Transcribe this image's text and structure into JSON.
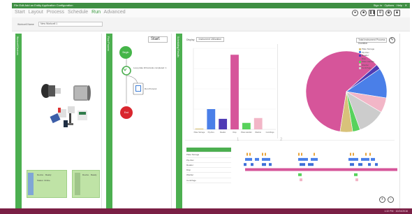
{
  "window": {
    "title_left": "File  Edit  Add an Entity  Application  Configuration",
    "title_right": "Sign in  ·  Options  ·  Help  ·  ✕"
  },
  "menu": {
    "items": [
      {
        "label": "Start"
      },
      {
        "label": "Layout"
      },
      {
        "label": "Process"
      },
      {
        "label": "Schedule"
      },
      {
        "label": "Run",
        "active": true
      },
      {
        "label": "Advanced"
      }
    ],
    "tool_icons": [
      "record-icon",
      "stop-icon",
      "pause-icon",
      "settings-icon",
      "database-icon",
      "user-icon"
    ]
  },
  "subbar": {
    "label": "Workcell Name",
    "select_value": "New Workcell 1"
  },
  "side_labels": {
    "devices": "Workcell Devices",
    "process": "Flow Process",
    "schedule": "Scheduling Results"
  },
  "devices": {
    "box1": {
      "title": "Device · Ready",
      "sub": "Status: Online"
    },
    "box2": {
      "title": "Device · Ready"
    }
  },
  "flow": {
    "start_select": "Start",
    "begin_label": "Begin",
    "end_label": "End",
    "loop_label": "Loop plate till barcode completed: 1",
    "step_label": "Run Protocol"
  },
  "chart_controls": {
    "label": "Display",
    "dropdown": "Instrument Utilization",
    "right_dropdown": "Total Instrument Process Duration"
  },
  "colors": {
    "green": "#4caf50",
    "dark_green": "#3f8f43",
    "taskbar": "#7a1f45"
  },
  "chart_data": [
    {
      "type": "bar",
      "categories": [
        "Plate Storage",
        "Pip-Dev",
        "Reader",
        "Disp",
        "Plate Handler",
        "Washer",
        "Centrifuge"
      ],
      "values": [
        1,
        25,
        13,
        92,
        8,
        14
      ],
      "colors": [
        "#d8c27a",
        "#4a7fe8",
        "#4f3bb5",
        "#d6559a",
        "#58d25c",
        "#f2b6c7"
      ],
      "ylim": [
        0,
        100
      ]
    },
    {
      "type": "pie",
      "series_names": [
        "Plate Storage",
        "Pip-Dev",
        "Reader",
        "Disp",
        "Plate Handler",
        "Washer",
        "Centrifuge"
      ],
      "values": [
        5,
        12,
        2,
        61,
        3,
        6,
        11
      ],
      "colors": [
        "#d8c27a",
        "#4a7fe8",
        "#4f3bb5",
        "#d6559a",
        "#58d25c",
        "#f2b6c7",
        "#cccccc"
      ]
    }
  ],
  "timeline": {
    "rows": [
      "Plate Storage",
      "Pip-Dev",
      "Reader",
      "Disp",
      "Washer",
      "Centrifuge"
    ],
    "markers": [
      "1",
      "2"
    ]
  },
  "taskbar": {
    "clock": "1:32 PM · 10/24/2016"
  }
}
